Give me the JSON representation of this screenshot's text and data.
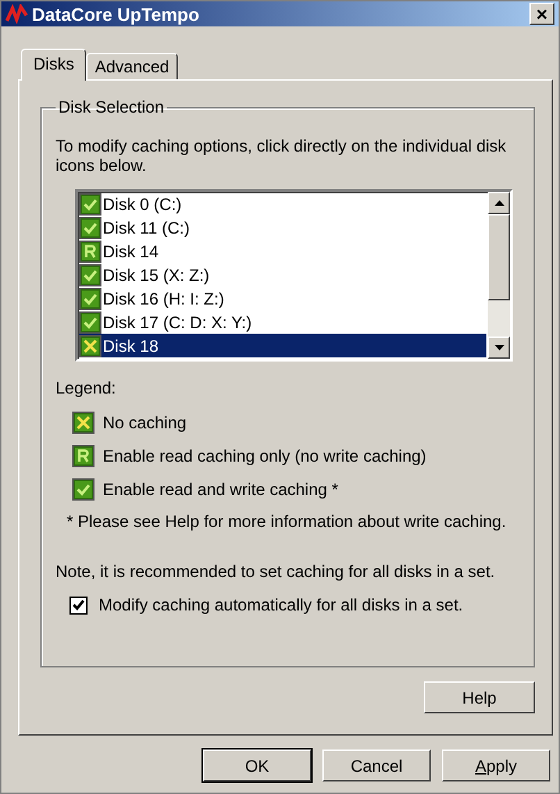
{
  "window": {
    "title": "DataCore UpTempo",
    "close": "×"
  },
  "tabs": [
    {
      "label": "Disks",
      "selected": true
    },
    {
      "label": "Advanced",
      "selected": false
    }
  ],
  "disk_selection": {
    "title": "Disk Selection",
    "instructions": "To modify caching options, click directly on the individual disk icons below.",
    "disks": [
      {
        "label": "Disk 0 (C:)",
        "kind": "readwrite",
        "selected": false
      },
      {
        "label": "Disk 11 (C:)",
        "kind": "readwrite",
        "selected": false
      },
      {
        "label": "Disk 14",
        "kind": "read",
        "selected": false
      },
      {
        "label": "Disk 15 (X: Z:)",
        "kind": "readwrite",
        "selected": false
      },
      {
        "label": "Disk 16 (H: I: Z:)",
        "kind": "readwrite",
        "selected": false
      },
      {
        "label": "Disk 17 (C: D: X: Y:)",
        "kind": "readwrite",
        "selected": false
      },
      {
        "label": "Disk 18",
        "kind": "none",
        "selected": true
      }
    ],
    "legend_title": "Legend:",
    "legend": [
      {
        "kind": "none",
        "label": "No caching"
      },
      {
        "kind": "read",
        "label": "Enable read caching only (no write caching)"
      },
      {
        "kind": "readwrite",
        "label": "Enable read and write caching *"
      }
    ],
    "footnote": "* Please see Help for more information about write caching.",
    "note": "Note, it is recommended to set caching for all disks in a set.",
    "auto_modify": {
      "label": "Modify caching automatically for all disks in a set.",
      "checked": true
    }
  },
  "help_button": "Help",
  "buttons": [
    {
      "label": "OK",
      "default": true,
      "mnemonic": false
    },
    {
      "label": "Cancel",
      "default": false,
      "mnemonic": false
    },
    {
      "label": "Apply",
      "default": false,
      "mnemonic": true
    }
  ]
}
